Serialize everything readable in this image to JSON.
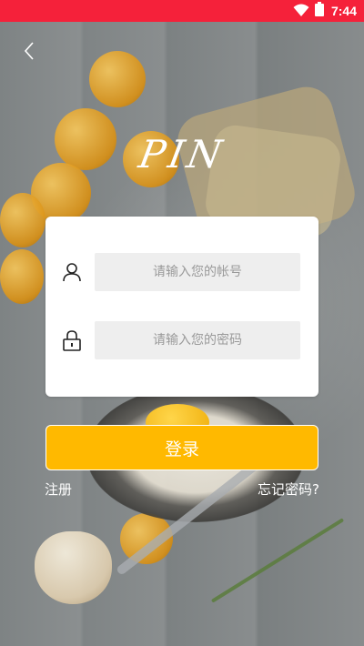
{
  "status_bar": {
    "time": "7:44",
    "background": "#f5213a"
  },
  "header": {
    "back_icon": "chevron-left-icon",
    "logo_text": "PIN"
  },
  "login_form": {
    "account_field": {
      "icon": "user-icon",
      "placeholder": "请输入您的帐号",
      "value": ""
    },
    "password_field": {
      "icon": "lock-icon",
      "placeholder": "请输入您的密码",
      "value": ""
    },
    "login_button": {
      "label": "登录",
      "color": "#ffb900"
    }
  },
  "footer_links": {
    "register": "注册",
    "forgot_password": "忘记密码?"
  }
}
